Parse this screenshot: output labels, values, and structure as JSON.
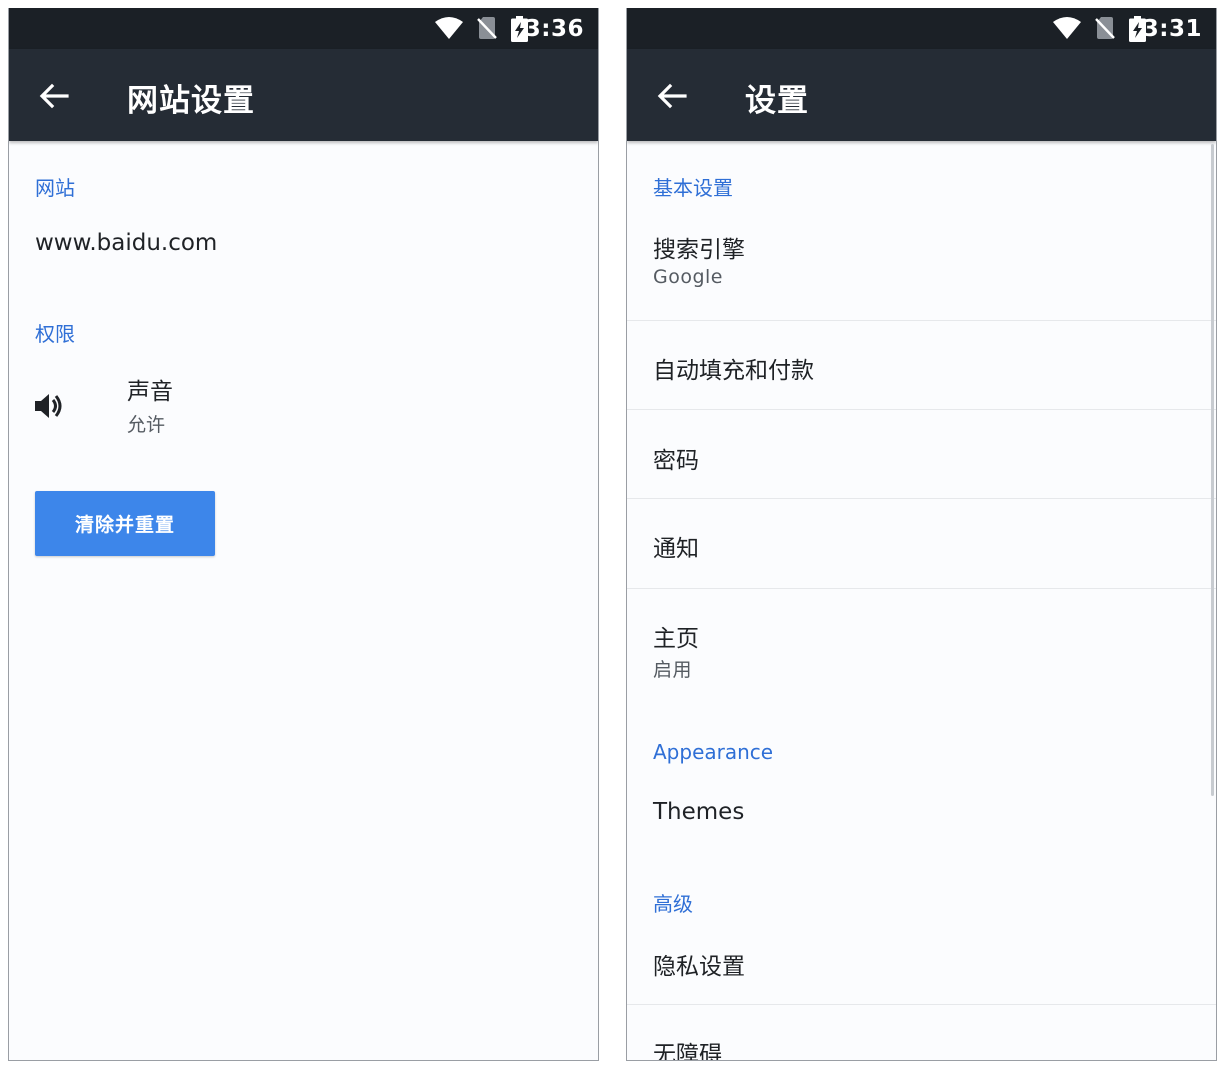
{
  "left": {
    "status_time": "3:36",
    "title": "网站设置",
    "site_section": "网站",
    "site_url": "www.baidu.com",
    "permissions_section": "权限",
    "sound_title": "声音",
    "sound_value": "允许",
    "clear_button": "清除并重置"
  },
  "right": {
    "status_time": "3:31",
    "title": "设置",
    "basic_section": "基本设置",
    "search_engine_title": "搜索引擎",
    "search_engine_value": "Google",
    "autofill": "自动填充和付款",
    "passwords": "密码",
    "notifications": "通知",
    "homepage_title": "主页",
    "homepage_value": "启用",
    "appearance_section": "Appearance",
    "themes": "Themes",
    "advanced_section": "高级",
    "privacy": "隐私设置",
    "accessibility": "无障碍"
  },
  "colors": {
    "statusbar": "#1b2026",
    "appbar": "#252c35",
    "accent": "#2f6fd6",
    "button": "#3d86ea",
    "background": "#fbfcfe"
  }
}
